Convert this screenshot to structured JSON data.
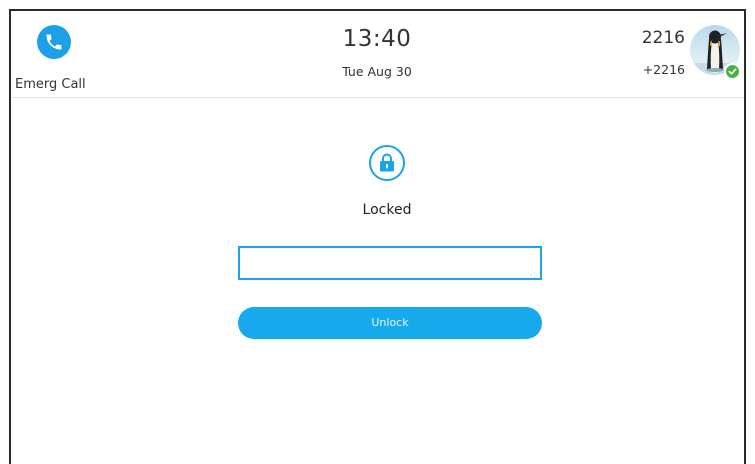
{
  "emergency": {
    "label": "Emerg Call",
    "icon": "phone-icon"
  },
  "clock": {
    "time": "13:40",
    "date": "Tue Aug 30"
  },
  "account": {
    "number": "2216",
    "extension": "+2216",
    "status": "online"
  },
  "lock_screen": {
    "icon": "lock-icon",
    "status_text": "Locked",
    "password_value": "",
    "unlock_label": "Unlock"
  },
  "colors": {
    "accent": "#1ea3e8",
    "button": "#16a9ec",
    "status_online": "#4cb04a",
    "text": "#333333"
  }
}
